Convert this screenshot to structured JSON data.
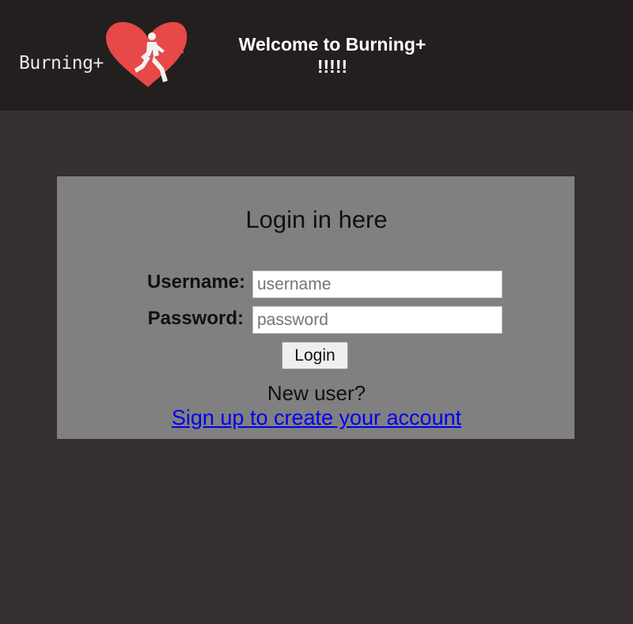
{
  "header": {
    "logo_text": "Burning+",
    "welcome_line1": "Welcome to Burning+",
    "welcome_line2": "!!!!!"
  },
  "login": {
    "title": "Login in here",
    "username_label": "Username:",
    "username_placeholder": "username",
    "password_label": "Password:",
    "password_placeholder": "password",
    "submit_label": "Login",
    "new_user_text": "New user?",
    "signup_link_text": "Sign up to create your account"
  },
  "colors": {
    "header_bg": "#231f1f",
    "page_bg": "#353131",
    "panel_bg": "#808080",
    "heart": "#e74848",
    "link": "#0000ee"
  }
}
